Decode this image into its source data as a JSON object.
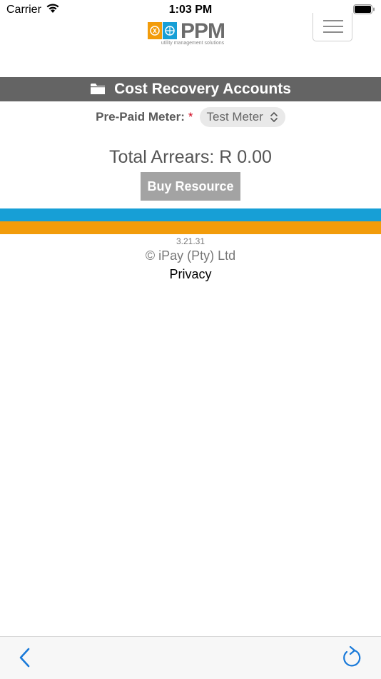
{
  "status_bar": {
    "carrier": "Carrier",
    "time": "1:03 PM"
  },
  "header": {
    "logo_text": "PPM",
    "logo_tagline": "utility management solutions"
  },
  "page": {
    "title": "Cost Recovery Accounts"
  },
  "meter": {
    "label": "Pre-Paid Meter:",
    "required_mark": "*",
    "selected": "Test Meter"
  },
  "arrears": {
    "text": "Total Arrears: R 0.00"
  },
  "buy_button": {
    "label": "Buy Resource"
  },
  "footer": {
    "version": "3.21.31",
    "copyright": "© iPay (Pty) Ltd",
    "privacy": "Privacy"
  },
  "colors": {
    "band": "#646464",
    "blue_stripe": "#179fd6",
    "orange_stripe": "#f29c0b",
    "accent": "#1a7ad9",
    "required": "#d0021b"
  },
  "icons": [
    "wifi-icon",
    "battery-icon",
    "hamburger-menu-icon",
    "folder-icon",
    "chevron-updown-icon",
    "back-icon",
    "reload-icon"
  ]
}
